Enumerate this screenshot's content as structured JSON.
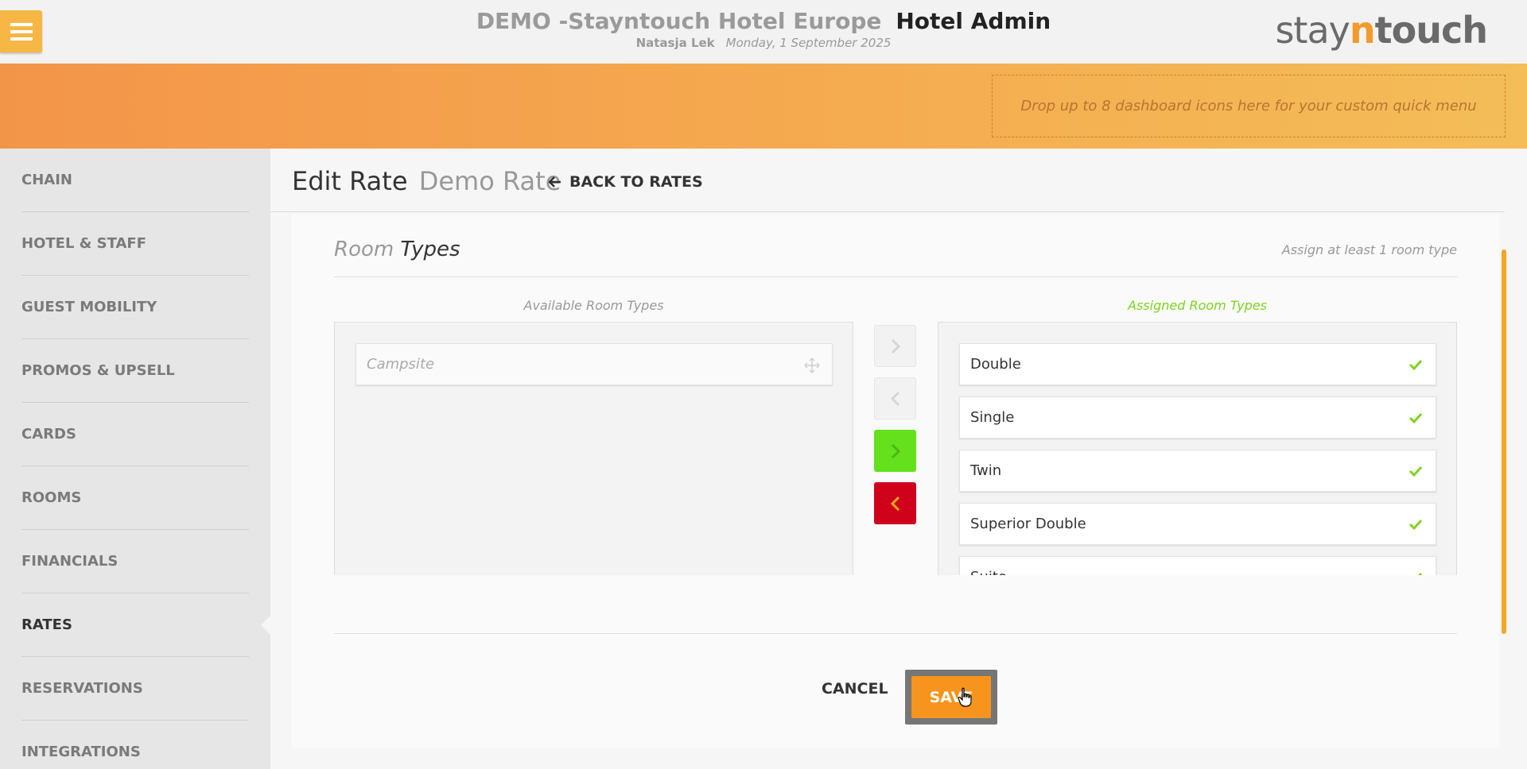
{
  "header": {
    "hotel_name": "DEMO -Stayntouch Hotel Europe",
    "module": "Hotel Admin",
    "user": "Natasja Lek",
    "date": "Monday, 1 September 2025",
    "logo": {
      "pre": "stay",
      "n": "n",
      "post": "touch"
    }
  },
  "banner": {
    "dropzone_text": "Drop up to 8 dashboard icons here for your custom quick menu"
  },
  "sidebar": {
    "items": [
      {
        "label": "CHAIN"
      },
      {
        "label": "HOTEL & STAFF"
      },
      {
        "label": "GUEST MOBILITY"
      },
      {
        "label": "PROMOS & UPSELL"
      },
      {
        "label": "CARDS"
      },
      {
        "label": "ROOMS"
      },
      {
        "label": "FINANCIALS"
      },
      {
        "label": "RATES"
      },
      {
        "label": "RESERVATIONS"
      },
      {
        "label": "INTEGRATIONS"
      }
    ],
    "active": "RATES"
  },
  "page": {
    "title": "Edit Rate",
    "rate_name": "Demo Rate",
    "back_label": "BACK TO RATES"
  },
  "room_types": {
    "title_light": "Room",
    "title_strong": "Types",
    "hint": "Assign at least 1 room type",
    "available_label": "Available Room Types",
    "assigned_label": "Assigned Room Types",
    "available": [
      "Campsite"
    ],
    "assigned": [
      "Double",
      "Single",
      "Twin",
      "Superior Double",
      "Suite"
    ]
  },
  "actions": {
    "cancel": "CANCEL",
    "save": "SAVE"
  },
  "colors": {
    "accent": "#f7941d",
    "banner_start": "#f39549",
    "banner_end": "#f4bd58",
    "assigned_label": "#7ed321",
    "add_button": "#64e01c",
    "remove_button": "#d0021b"
  }
}
